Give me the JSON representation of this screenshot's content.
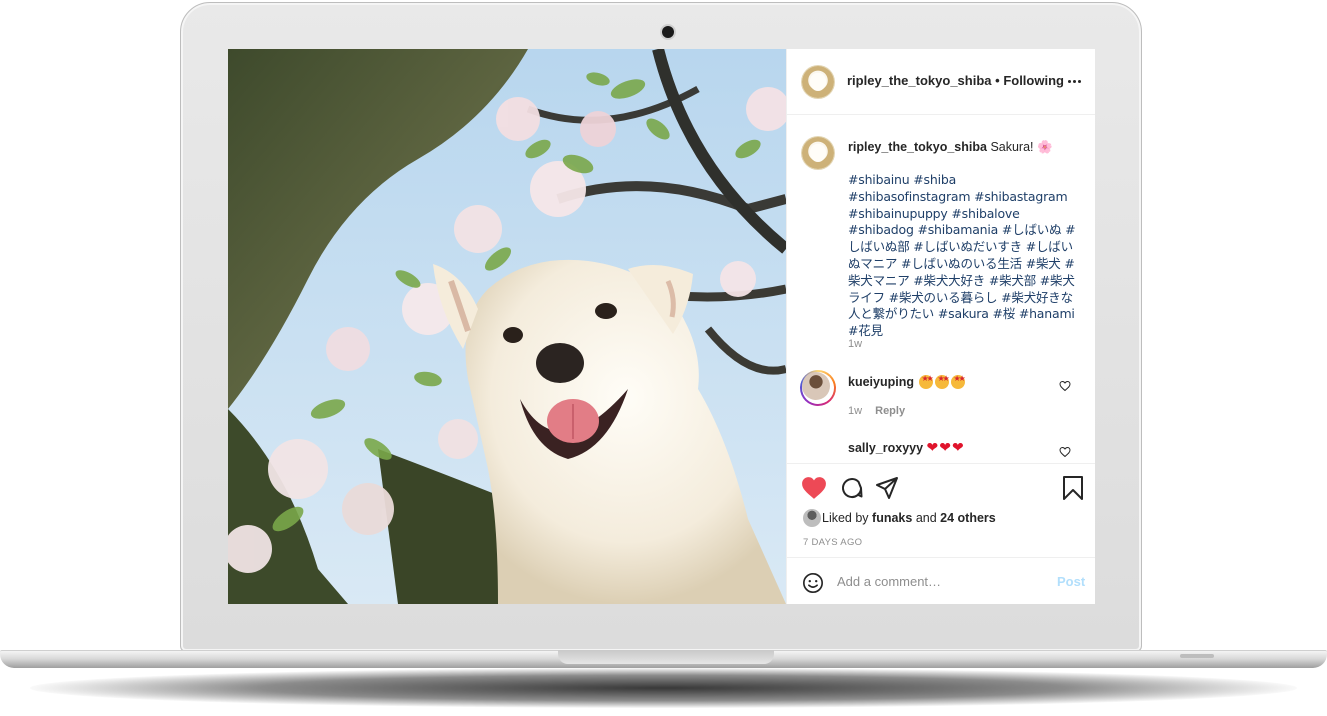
{
  "post": {
    "username": "ripley_the_tokyo_shiba",
    "separator": "•",
    "follow_status": "Following",
    "caption_text": "Sakura! 🌸",
    "hashtags": "#shibainu #shiba #shibasofinstagram #shibastagram #shibainupuppy #shibalove #shibadog #shibamania #しばいぬ #しばいぬ部 #しばいぬだいすき #しばいぬマニア #しばいぬのいる生活 #柴犬 #柴犬マニア #柴犬大好き #柴犬部 #柴犬ライフ #柴犬のいる暮らし #柴犬好きな人と繋がりたい #sakura #桜 #hanami #花見",
    "caption_time": "1w"
  },
  "comments": [
    {
      "user": "kueiyuping",
      "emoji": [
        "star-struck",
        "star-struck",
        "star-struck"
      ],
      "time": "1w",
      "reply_label": "Reply"
    },
    {
      "user": "sally_roxyyy",
      "emoji": [
        "❤",
        "❤",
        "❤"
      ]
    }
  ],
  "actions": {
    "liked_prefix": "Liked by",
    "liked_user": "funaks",
    "liked_and": "and",
    "liked_others": "24 others",
    "date": "7 DAYS AGO"
  },
  "add_comment": {
    "placeholder": "Add a comment…",
    "post_label": "Post"
  },
  "icons": {
    "more": "more-options-icon",
    "like": "heart-icon",
    "comment": "comment-icon",
    "share": "share-icon",
    "save": "bookmark-icon",
    "emoji": "smile-icon"
  },
  "colors": {
    "like_red": "#ed4956",
    "hashtag_blue": "#1f3f68",
    "post_disabled": "#b2dffc",
    "muted_text": "#8e8e8e"
  }
}
